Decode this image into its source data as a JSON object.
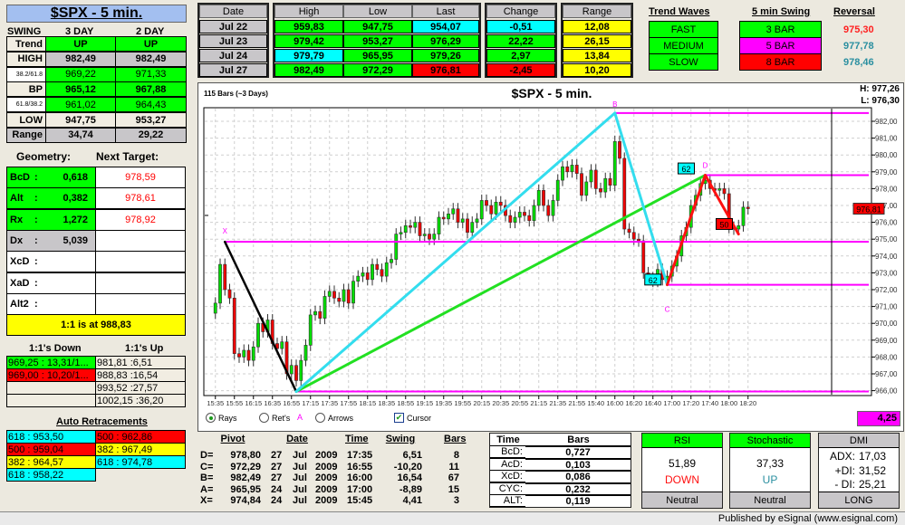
{
  "colors": {
    "green": "#00ff00",
    "cyan": "#00ffff",
    "red": "#ff0000",
    "yellow": "#ffff00",
    "magenta": "#ff00ff",
    "gray": "#c8c6c9",
    "cream": "#f1ede2",
    "white": "#ffffff",
    "blue": "#a3bff0"
  },
  "left": {
    "title": "$SPX - 5 min.",
    "swing_label": "SWING",
    "col_headers": [
      "3 DAY",
      "2 DAY"
    ],
    "rows": [
      {
        "label": "Trend",
        "values": [
          "UP",
          "UP"
        ],
        "lbg": "#f1ede2",
        "bg": "#00ff00"
      },
      {
        "label": "HIGH",
        "values": [
          "982,49",
          "982,49"
        ],
        "lbg": "#f1ede2",
        "bg": "#c8c6c9"
      },
      {
        "label": "38.2/61.8",
        "values": [
          "969,22",
          "971,33"
        ],
        "lbg": "#ffffff",
        "bg": "#00ff00"
      },
      {
        "label": "BP",
        "values": [
          "965,12",
          "967,88"
        ],
        "lbg": "#f1ede2",
        "bg": "#00ff00"
      },
      {
        "label": "61.8/38.2",
        "values": [
          "961,02",
          "964,43"
        ],
        "lbg": "#ffffff",
        "bg": "#00ff00"
      },
      {
        "label": "LOW",
        "values": [
          "947,75",
          "953,27"
        ],
        "lbg": "#f1ede2",
        "bg": "#f1ede2"
      },
      {
        "label": "Range",
        "values": [
          "34,74",
          "29,22"
        ],
        "lbg": "#c8c6c9",
        "bg": "#c8c6c9"
      }
    ]
  },
  "geometry": {
    "title": "Geometry:",
    "target_title": "Next Target:",
    "rows": [
      {
        "label": "BcD",
        "sep": ":",
        "value": "0,618",
        "target": "978,59",
        "bg": "#00ff00"
      },
      {
        "label": "Alt",
        "sep": ":",
        "value": "0,382",
        "target": "978,61",
        "bg": "#00ff00"
      },
      {
        "label": "Rx",
        "sep": ":",
        "value": "1,272",
        "target": "978,92",
        "bg": "#00ff00"
      },
      {
        "label": "Dx",
        "sep": ":",
        "value": "5,039",
        "target": "",
        "bg": "#c8c6c9"
      },
      {
        "label": "XcD",
        "sep": ":",
        "value": "",
        "target": "",
        "bg": "#ffffff"
      },
      {
        "label": "XaD",
        "sep": ":",
        "value": "",
        "target": "",
        "bg": "#ffffff"
      },
      {
        "label": "Alt2",
        "sep": ":",
        "value": "",
        "target": "",
        "bg": "#ffffff"
      }
    ],
    "one_to_one": "1:1 is at 988,83"
  },
  "ones": {
    "down_title": "1:1's Down",
    "up_title": "1:1's Up",
    "down": [
      {
        "text": "969,25 : 13,31/1...",
        "bg": "#00ff00"
      },
      {
        "text": "969,00 : 10,20/1...",
        "bg": "#ff0000"
      },
      {
        "text": "",
        "bg": "#f1ede2"
      },
      {
        "text": "",
        "bg": "#f1ede2"
      }
    ],
    "up": [
      {
        "text": "981,81 :6,51"
      },
      {
        "text": "988,83 :16,54"
      },
      {
        "text": "993,52 :27,57"
      },
      {
        "text": "1002,15 :36,20"
      }
    ]
  },
  "retracements": {
    "title": "Auto Retracements",
    "left": [
      {
        "text": "618 : 953,50",
        "bg": "#00ffff"
      },
      {
        "text": "500 : 959,04",
        "bg": "#ff0000"
      },
      {
        "text": "382 : 964,57",
        "bg": "#ffff00"
      },
      {
        "text": "618 : 958,22",
        "bg": "#00ffff"
      }
    ],
    "right": [
      {
        "text": "500 : 962,86",
        "bg": "#ff0000"
      },
      {
        "text": "382 : 967,49",
        "bg": "#ffff00"
      },
      {
        "text": "618 : 974,78",
        "bg": "#00ffff"
      }
    ]
  },
  "daily": {
    "headers": {
      "date": "Date",
      "high": "High",
      "low": "Low",
      "last": "Last",
      "change": "Change",
      "range": "Range"
    },
    "rows": [
      {
        "date": "Jul  22",
        "high": "959,83",
        "low": "947,75",
        "last": "954,07",
        "change": "-0,51",
        "range": "12,08",
        "bg": [
          "#00ff00",
          "#00ff00",
          "#00ffff",
          "#00ffff",
          "#ffff00"
        ]
      },
      {
        "date": "Jul  23",
        "high": "979,42",
        "low": "953,27",
        "last": "976,29",
        "change": "22,22",
        "range": "26,15",
        "bg": [
          "#00ff00",
          "#00ff00",
          "#00ff00",
          "#00ff00",
          "#ffff00"
        ]
      },
      {
        "date": "Jul  24",
        "high": "979,79",
        "low": "965,95",
        "last": "979,26",
        "change": "2,97",
        "range": "13,84",
        "bg": [
          "#00ffff",
          "#00ff00",
          "#00ff00",
          "#00ff00",
          "#ffff00"
        ]
      },
      {
        "date": "Jul  27",
        "high": "982,49",
        "low": "972,29",
        "last": "976,81",
        "change": "-2,45",
        "range": "10,20",
        "bg": [
          "#00ff00",
          "#00ff00",
          "#ff0000",
          "#ff0000",
          "#ffff00"
        ]
      }
    ]
  },
  "waves": {
    "trend_title": "Trend Waves",
    "swing_title": "5 min Swing",
    "reversal_title": "Reversal",
    "trend": [
      {
        "label": "FAST",
        "bg": "#00ff00"
      },
      {
        "label": "MEDIUM",
        "bg": "#00ff00"
      },
      {
        "label": "SLOW",
        "bg": "#00ff00"
      }
    ],
    "swing": [
      {
        "label": "3 BAR",
        "bg": "#00ff00"
      },
      {
        "label": "5 BAR",
        "bg": "#ff00ff"
      },
      {
        "label": "8 BAR",
        "bg": "#ff0000"
      }
    ],
    "reversal": [
      {
        "value": "975,30",
        "color": "#ff2020"
      },
      {
        "value": "977,78",
        "color": "#2a8fa0"
      },
      {
        "value": "978,46",
        "color": "#2a8fa0"
      }
    ]
  },
  "chart": {
    "bars_info": "115 Bars (~3 Days)",
    "title": "$SPX - 5 min.",
    "high": "H: 977,26",
    "low": "L: 976,30",
    "last_price": "976,81",
    "y_ticks": [
      "982,00",
      "981,00",
      "980,00",
      "979,00",
      "978,00",
      "977,00",
      "976,00",
      "975,00",
      "974,00",
      "973,00",
      "972,00",
      "971,00",
      "970,00",
      "969,00",
      "968,00",
      "967,00",
      "966,00"
    ],
    "y_tick_values": [
      982,
      981,
      980,
      979,
      978,
      977,
      976,
      975,
      974,
      973,
      972,
      971,
      970,
      969,
      968,
      967,
      966
    ],
    "x_ticks": [
      "15:35",
      "15:55",
      "16:15",
      "16:35",
      "16:55",
      "17:15",
      "17:35",
      "17:55",
      "18:15",
      "18:35",
      "18:55",
      "19:15",
      "19:35",
      "19:55",
      "20:15",
      "20:35",
      "20:55",
      "21:15",
      "21:35",
      "21:55",
      "15:40",
      "16:00",
      "16:20",
      "16:40",
      "17:00",
      "17:20",
      "17:40",
      "18:00",
      "18:20"
    ],
    "bars_per_tick": 4,
    "closes": [
      971.2,
      973.5,
      972.0,
      971.5,
      968.2,
      968.0,
      968.4,
      967.8,
      968.6,
      970.0,
      969.5,
      970.2,
      968.8,
      968.5,
      968.9,
      967.0,
      967.5,
      966.6,
      967.8,
      968.7,
      970.5,
      970.7,
      970.3,
      971.6,
      971.9,
      971.5,
      971.3,
      972.0,
      971.2,
      972.5,
      972.8,
      973.0,
      972.6,
      973.5,
      973.2,
      972.8,
      973.6,
      973.8,
      975.3,
      975.4,
      975.8,
      975.7,
      976.0,
      975.2,
      975.3,
      975.0,
      975.3,
      976.3,
      976.2,
      976.5,
      976.8,
      976.0,
      976.2,
      975.4,
      976.0,
      976.2,
      977.3,
      977.0,
      976.5,
      977.2,
      977.0,
      976.4,
      976.0,
      976.3,
      976.6,
      976.4,
      976.1,
      977.0,
      977.9,
      977.0,
      976.4,
      977.3,
      978.5,
      979.3,
      979.0,
      979.4,
      978.9,
      977.6,
      978.4,
      979.1,
      978.0,
      977.8,
      978.6,
      978.2,
      980.8,
      979.8,
      975.6,
      975.4,
      975.0,
      974.9,
      973.0,
      972.7,
      972.5,
      973.2,
      972.6,
      972.8,
      973.4,
      974.0,
      975.2,
      975.7,
      977.0,
      977.6,
      978.3,
      978.5,
      978.0,
      977.9,
      978.0,
      977.7,
      975.7,
      975.6,
      975.8,
      976.9,
      976.81
    ],
    "pivots": {
      "X": {
        "bar": 2,
        "price": 974.84
      },
      "A": {
        "bar": 17,
        "price": 965.95
      },
      "B": {
        "bar": 84,
        "price": 982.49
      },
      "C": {
        "bar": 95,
        "price": 972.29
      },
      "D": {
        "bar": 103,
        "price": 978.8
      },
      "E": {
        "bar": 110,
        "price": 975.3
      }
    },
    "tags": [
      {
        "text": "62",
        "bg": "#00ffff",
        "bar": 99,
        "price": 979.2
      },
      {
        "text": "62",
        "bg": "#00ffff",
        "bar": 92,
        "price": 972.6
      },
      {
        "text": "50",
        "bg": "#ff0000",
        "bar": 107,
        "price": 975.9
      }
    ],
    "controls": {
      "rays": "Rays",
      "rets": "Ret's",
      "arrows": "Arrows",
      "cursor": "Cursor",
      "cursor_check": "✔",
      "a_label": "A"
    },
    "readout": "4,25"
  },
  "pivot_table": {
    "headers": {
      "pivot": "Pivot",
      "date": "Date",
      "time": "Time",
      "swing": "Swing",
      "bars": "Bars"
    },
    "rows": [
      {
        "label": "D=",
        "price": "978,80",
        "day": "27",
        "month": "Jul",
        "year": "2009",
        "time": "17:35",
        "swing": "6,51",
        "bars": "8"
      },
      {
        "label": "C=",
        "price": "972,29",
        "day": "27",
        "month": "Jul",
        "year": "2009",
        "time": "16:55",
        "swing": "-10,20",
        "bars": "11"
      },
      {
        "label": "B=",
        "price": "982,49",
        "day": "27",
        "month": "Jul",
        "year": "2009",
        "time": "16:00",
        "swing": "16,54",
        "bars": "67"
      },
      {
        "label": "A=",
        "price": "965,95",
        "day": "24",
        "month": "Jul",
        "year": "2009",
        "time": "17:00",
        "swing": "-8,89",
        "bars": "15"
      },
      {
        "label": "X=",
        "price": "974,84",
        "day": "24",
        "month": "Jul",
        "year": "2009",
        "time": "15:45",
        "swing": "4,41",
        "bars": "3"
      }
    ]
  },
  "ratio_table": {
    "headers": {
      "time": "Time",
      "bars": "Bars"
    },
    "rows": [
      {
        "label": "BcD:",
        "value": "0,727"
      },
      {
        "label": "AcD:",
        "value": "0,103"
      },
      {
        "label": "XcD:",
        "value": "0,086"
      },
      {
        "label": "CYC:",
        "value": "0,232"
      },
      {
        "label": "ALT:",
        "value": "0,119"
      }
    ]
  },
  "indicators": {
    "rsi": {
      "title": "RSI",
      "value": "51,89",
      "direction": "DOWN",
      "status": "Neutral"
    },
    "stoch": {
      "title": "Stochastic",
      "value": "37,33",
      "direction": "UP",
      "status": "Neutral"
    },
    "dmi": {
      "title": "DMI",
      "adx_label": "ADX:",
      "adx": "17,03",
      "pdi_label": "+DI:",
      "pdi": "31,52",
      "mdi_label": "- DI:",
      "mdi": "25,21",
      "status": "LONG"
    }
  },
  "footer": "Published by eSignal (www.esignal.com)"
}
